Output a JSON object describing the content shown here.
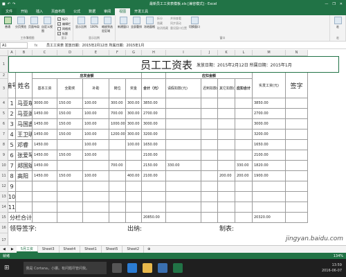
{
  "window": {
    "title": "最新员工工资表模板.xls [兼容模式] - Excel",
    "minimize": "—",
    "restore": "❐",
    "close": "✕"
  },
  "ribbon_tabs": [
    "文件",
    "开始",
    "插入",
    "页面布局",
    "公式",
    "数据",
    "审阅",
    "视图",
    "开发工具"
  ],
  "ribbon": {
    "views": {
      "labels": [
        "普通",
        "分页预览",
        "页面布局",
        "自定义视图"
      ],
      "group": "工作簿视图"
    },
    "show": {
      "items": [
        "标尺",
        "编辑栏",
        "网格线",
        "标题"
      ],
      "group": "显示"
    },
    "zoom": {
      "labels": [
        "显示比例",
        "100%",
        "缩放到选定区域"
      ],
      "group": "显示比例"
    },
    "window": {
      "labels": [
        "新建窗口",
        "全部重排",
        "冻结窗格"
      ],
      "small": [
        "拆分",
        "隐藏",
        "取消隐藏"
      ],
      "extra": [
        "并排查看",
        "同步滚动",
        "重设窗口位置"
      ],
      "switch": "切换窗口",
      "group": "窗口"
    },
    "macro": {
      "label": "宏",
      "group": "宏"
    }
  },
  "formula_bar": {
    "name_box": "A1",
    "fx": "fx",
    "content": "员工工资表   发放日期：2015年2月12日 所属日期：2015年1月"
  },
  "columns": [
    "A",
    "B",
    "C",
    "D",
    "E",
    "F",
    "G",
    "H",
    "I",
    "J",
    "K",
    "L",
    "M",
    "N"
  ],
  "rows": [
    "1",
    "2",
    "3",
    "4",
    "5",
    "6",
    "7",
    "8",
    "9",
    "10",
    "11",
    "12",
    "13",
    "14",
    "15",
    "16",
    "17",
    "18"
  ],
  "sheet": {
    "title": "员工工资表",
    "subtitle": "发放日期：2015年2月12日 所属日期：2015年1月",
    "headers": {
      "num": "编号",
      "name": "姓名",
      "payable": "应发金额",
      "deduct": "应扣金额",
      "base": "基本工资",
      "attend": "全勤奖",
      "subsidy": "补助",
      "post": "岗位",
      "bonus": "奖金",
      "total": "合计（元）",
      "leave": "请假扣款(元)",
      "late": "迟到扣款(元)",
      "other": "其它扣款(元)",
      "deduct_total": "应扣合计",
      "actual": "实发工资(元)",
      "sign": "签字"
    },
    "data_rows": [
      [
        "1",
        "马亚萌",
        "3000.00",
        "150.00",
        "100.00",
        "300.00",
        "300.00",
        "3850.00",
        "",
        "",
        "",
        "",
        "3850.00"
      ],
      [
        "2",
        "马亚阁",
        "1450.00",
        "150.00",
        "100.00",
        "700.00",
        "300.00",
        "2700.00",
        "",
        "",
        "",
        "",
        "2700.00"
      ],
      [
        "3",
        "马国鑫",
        "1450.00",
        "150.00",
        "100.00",
        "1000.00",
        "300.00",
        "3000.00",
        "",
        "",
        "",
        "",
        "3000.00"
      ],
      [
        "4",
        "王卫明",
        "1450.00",
        "150.00",
        "100.00",
        "1200.00",
        "300.00",
        "3200.00",
        "",
        "",
        "",
        "",
        "3200.00"
      ],
      [
        "5",
        "邓睿",
        "1450.00",
        "",
        "100.00",
        "",
        "100.00",
        "1650.00",
        "",
        "",
        "",
        "",
        "1650.00"
      ],
      [
        "6",
        "张爱琴",
        "1450.00",
        "150.00",
        "100.00",
        "",
        "",
        "2100.00",
        "",
        "",
        "",
        "",
        "2100.00"
      ],
      [
        "7",
        "郑国斌",
        "1450.00",
        "",
        "",
        "700.00",
        "",
        "2150.00",
        "330.00",
        "",
        "",
        "330.00",
        "1820.00"
      ],
      [
        "8",
        "高阳",
        "1450.00",
        "150.00",
        "100.00",
        "",
        "400.00",
        "2100.00",
        "",
        "",
        "200.00",
        "200.00",
        "1900.00"
      ],
      [
        "9",
        "",
        "",
        "",
        "",
        "",
        "",
        "",
        "",
        "",
        "",
        "",
        ""
      ],
      [
        "10",
        "",
        "",
        "",
        "",
        "",
        "",
        "",
        "",
        "",
        "",
        "",
        ""
      ],
      [
        "11",
        "",
        "",
        "",
        "",
        "",
        "",
        "",
        "",
        "",
        "",
        "",
        ""
      ]
    ],
    "footer_total_label": "分栏合计",
    "footer_total": "20850.00",
    "footer_actual": "20320.00",
    "sign_leader": "领导签字:",
    "sign_cashier": "出纳:",
    "sign_maker": "制表:"
  },
  "sheet_tabs": [
    "5月工资",
    "Sheet3",
    "Sheet4",
    "Sheet1",
    "Sheet5",
    "Sheet2"
  ],
  "status": {
    "left": "就绪",
    "zoom": "134%"
  },
  "taskbar": {
    "search": "我是 Cortana，小娜。有问题尽管问我。",
    "time": "13:59",
    "date": "2016-06-07"
  },
  "watermark": "jingyan.baidu.com",
  "colors": {
    "accent": "#217346"
  }
}
